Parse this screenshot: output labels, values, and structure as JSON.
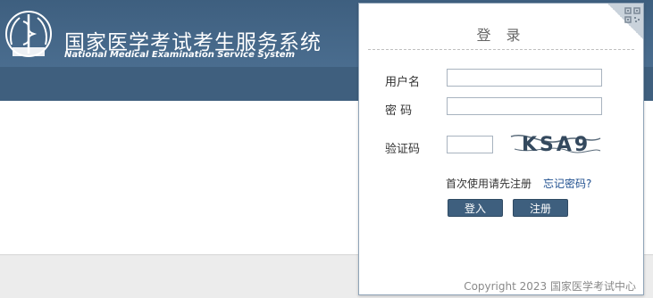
{
  "header": {
    "title_cn": "国家医学考试考生服务系统",
    "title_en": "National Medical Examination Service System",
    "colors": {
      "primary": "#3e5f7e",
      "band": "#3f5f7e",
      "footer": "#ececec"
    }
  },
  "login": {
    "title": "登 录",
    "username_label": "用户名",
    "username_value": "",
    "password_label": "密 码",
    "password_value": "",
    "captcha_label": "验证码",
    "captcha_value": "",
    "captcha_text": "KSA9",
    "register_hint": "首次使用请先注册",
    "forgot_link": "忘记密码?",
    "login_button": "登入",
    "register_button": "注册",
    "copyright": "Copyright 2023 国家医学考试中心"
  },
  "icons": {
    "logo": "medical-emblem-icon",
    "qr": "qr-code-icon"
  }
}
